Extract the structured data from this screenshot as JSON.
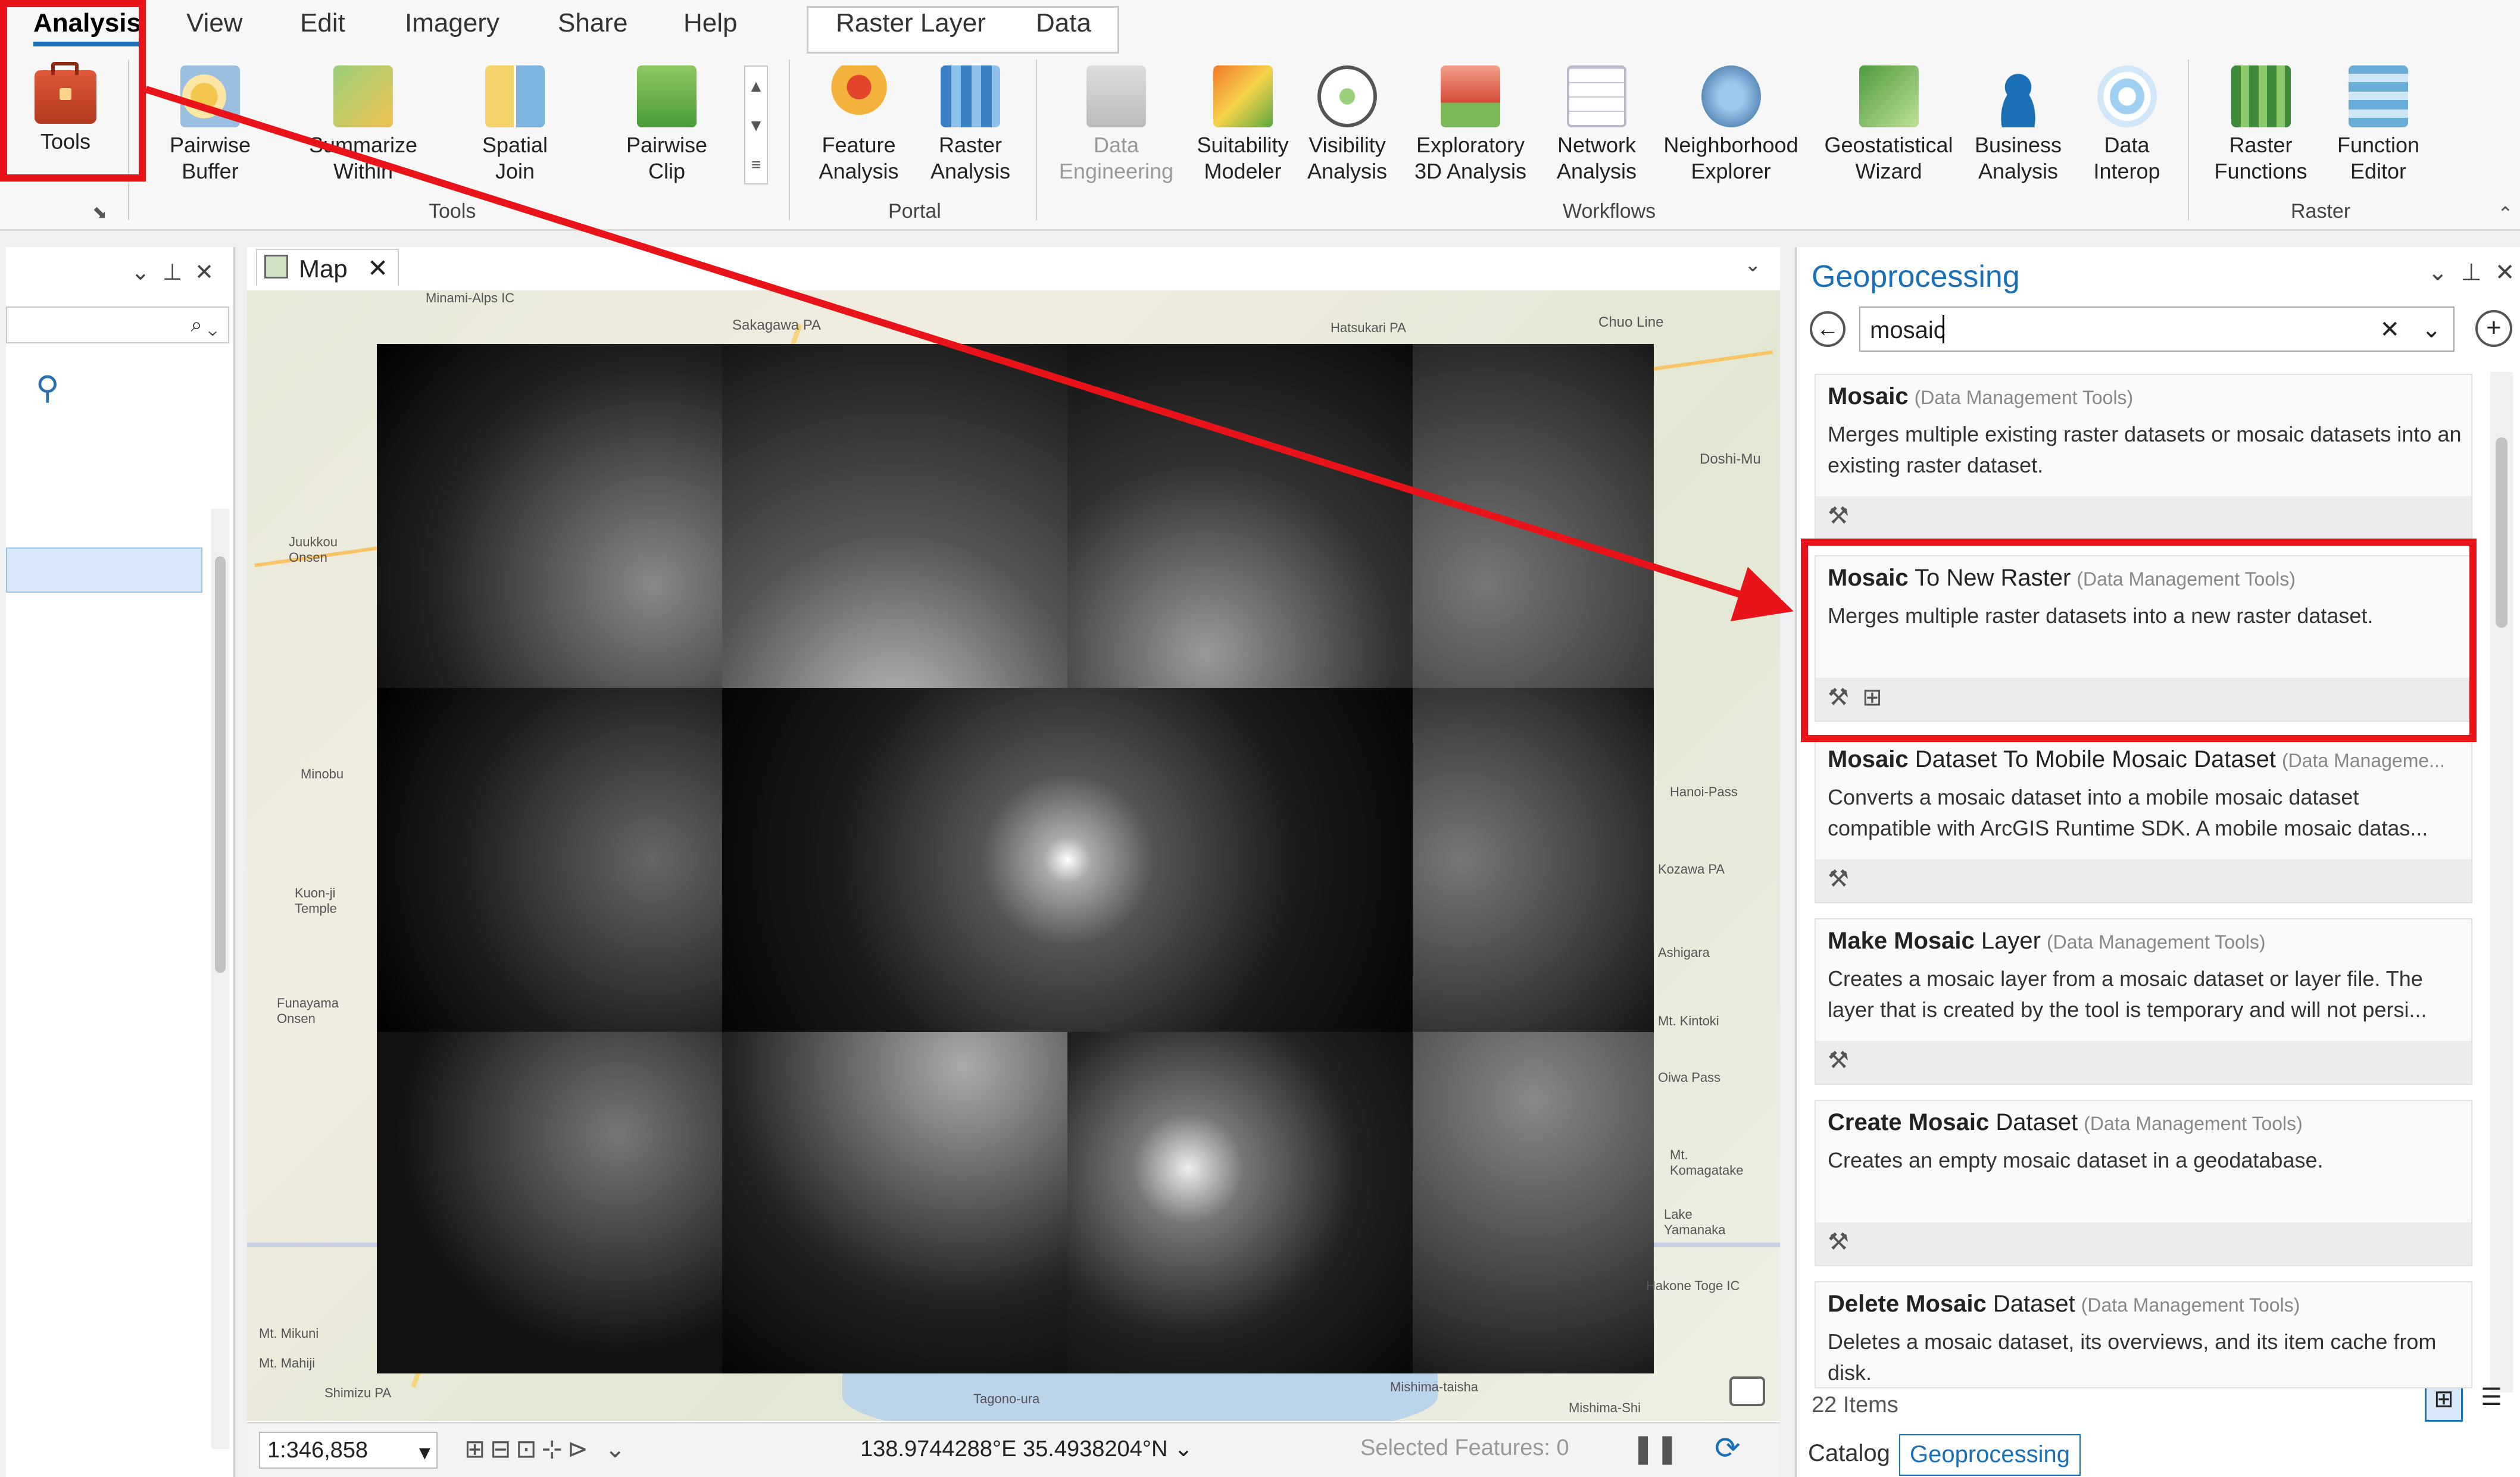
{
  "ribbon": {
    "tabs": [
      "Analysis",
      "View",
      "Edit",
      "Imagery",
      "Share",
      "Help"
    ],
    "context_tabs": [
      "Raster Layer",
      "Data"
    ],
    "tools_button": "Tools",
    "gallery": [
      "Pairwise\nBuffer",
      "Summarize\nWithin",
      "Spatial\nJoin",
      "Pairwise\nClip"
    ],
    "portal": [
      "Feature\nAnalysis",
      "Raster\nAnalysis"
    ],
    "workflows": [
      "Data\nEngineering",
      "Suitability\nModeler",
      "Visibility\nAnalysis",
      "Exploratory\n3D Analysis",
      "Network\nAnalysis",
      "Neighborhood\nExplorer",
      "Geostatistical\nWizard",
      "Business\nAnalysis",
      "Data\nInterop"
    ],
    "raster": [
      "Raster\nFunctions",
      "Function\nEditor"
    ],
    "groups": {
      "tools": "Tools",
      "portal": "Portal",
      "workflows": "Workflows",
      "raster": "Raster"
    }
  },
  "map": {
    "tab_label": "Map",
    "scale": "1:346,858",
    "coordinates": "138.9744288°E 35.4938204°N",
    "selected_features": "Selected Features: 0",
    "labels": [
      "Minami-Alps IC",
      "Sakagawa PA",
      "Hatsukari PA",
      "Chuo Line",
      "Doshi-Mu",
      "Juukkou Onsen",
      "Minobu",
      "Kuon-ji Temple",
      "Funayama Onsen",
      "Mt. Mikuni",
      "Ashigara",
      "Kozawa PA",
      "Mt. Kintoki",
      "Hakone Toge IC",
      "Mt. Mahiji",
      "Tagono-ura",
      "Shimizu PA",
      "Mishima-taisha",
      "Mishima-Shi",
      "Oiwa Pass",
      "Lake Yamanaka",
      "Mt. Komagatake",
      "Hanoi-Pass"
    ]
  },
  "geoprocessing": {
    "title": "Geoprocessing",
    "search_value": "mosaic",
    "items_count": "22 Items",
    "results": [
      {
        "bold": "Mosaic",
        "rest": "",
        "category": "(Data Management Tools)",
        "desc": "Merges multiple existing raster datasets or mosaic datasets into an existing raster dataset."
      },
      {
        "bold": "Mosaic",
        "rest": " To New Raster",
        "category": "(Data Management Tools)",
        "desc": "Merges multiple raster datasets into a new raster dataset."
      },
      {
        "bold": "Mosaic",
        "rest": " Dataset To Mobile Mosaic Dataset",
        "category": "(Data Manageme...",
        "desc": "Converts a mosaic dataset into a mobile mosaic dataset compatible with ArcGIS Runtime SDK. A mobile mosaic datas..."
      },
      {
        "bold": "Make Mosaic",
        "rest": " Layer",
        "category": "(Data Management Tools)",
        "desc": "Creates a  mosaic layer from a mosaic dataset or layer file. The layer that is created by the tool is temporary and will not persi..."
      },
      {
        "bold": "Create Mosaic",
        "rest": " Dataset",
        "category": "(Data Management Tools)",
        "desc": "Creates an empty mosaic dataset in a geodatabase."
      },
      {
        "bold": "Delete Mosaic",
        "rest": " Dataset",
        "category": "(Data Management Tools)",
        "desc": "Deletes a mosaic dataset, its overviews, and its item cache from disk."
      }
    ],
    "bottom_tabs": [
      "Catalog",
      "Geoprocessing"
    ]
  },
  "colors": {
    "accent": "#1a6fb5",
    "highlight": "#e8141a"
  }
}
